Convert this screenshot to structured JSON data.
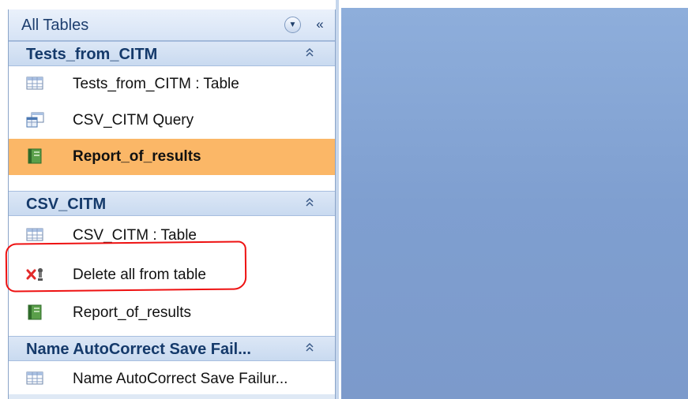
{
  "nav_pane": {
    "title": "All Tables",
    "filter_icon": "chevron-down-circle-icon",
    "collapse_icon": "double-chevron-left-icon",
    "collapse_glyph": "«",
    "filter_glyph": "▼",
    "groups": [
      {
        "label": "Tests_from_CITM",
        "chevron": "⌃",
        "items": [
          {
            "label": "Tests_from_CITM : Table",
            "icon": "table-icon",
            "selected": false
          },
          {
            "label": "CSV_CITM Query",
            "icon": "query-icon",
            "selected": false
          },
          {
            "label": "Report_of_results",
            "icon": "report-icon",
            "selected": true
          }
        ]
      },
      {
        "label": "CSV_CITM",
        "chevron": "⌃",
        "items": [
          {
            "label": "CSV_CITM : Table",
            "icon": "table-icon",
            "selected": false
          },
          {
            "label": "Delete all from table",
            "icon": "delete-query-icon",
            "selected": false
          },
          {
            "label": "Report_of_results",
            "icon": "report-icon",
            "selected": false
          }
        ]
      },
      {
        "label": "Name AutoCorrect Save Fail...",
        "chevron": "⌃",
        "items": [
          {
            "label": "Name AutoCorrect Save Failur...",
            "icon": "table-icon",
            "selected": false
          }
        ]
      }
    ]
  },
  "colors": {
    "selected_row": "#fbb767",
    "group_header": "#c9daf0",
    "workspace": "#819fd0",
    "annotation": "#ee1111"
  }
}
